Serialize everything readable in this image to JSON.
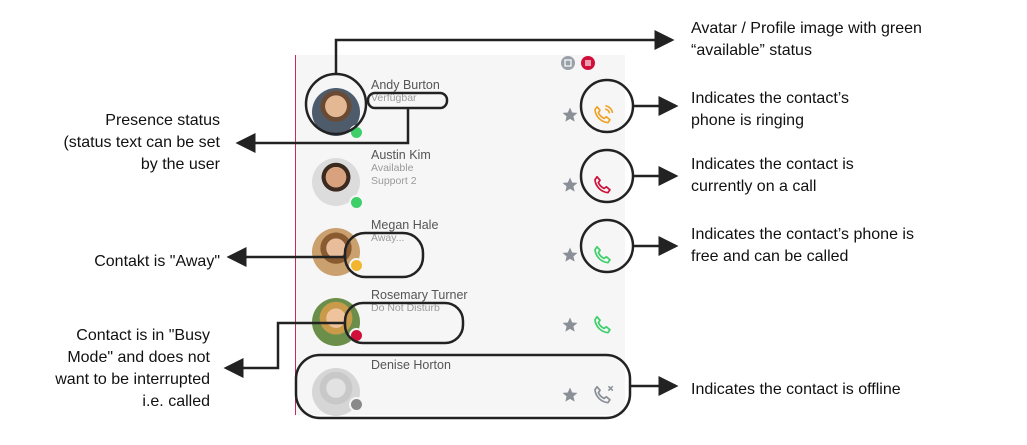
{
  "contacts": [
    {
      "name": "Andy Burton",
      "status": "Verfügbar",
      "extra": "",
      "presence": "available",
      "call_state": "ringing"
    },
    {
      "name": "Austin Kim",
      "status": "Available",
      "extra": "Support 2",
      "presence": "available",
      "call_state": "on-call"
    },
    {
      "name": "Megan Hale",
      "status": "Away...",
      "extra": "",
      "presence": "away",
      "call_state": "free"
    },
    {
      "name": "Rosemary Turner",
      "status": "Do Not Disturb",
      "extra": "",
      "presence": "busy",
      "call_state": "free"
    },
    {
      "name": "Denise Horton",
      "status": "",
      "extra": "",
      "presence": "offline",
      "call_state": "offline"
    }
  ],
  "annotations": {
    "avatar": [
      "Avatar / Profile image with green",
      "“available” status"
    ],
    "ringing": [
      "Indicates the contact’s",
      "phone is ringing"
    ],
    "on_call": [
      "Indicates the contact is",
      "currently on a call"
    ],
    "free": [
      "Indicates the contact’s phone is",
      "free and can be called"
    ],
    "offline": [
      "Indicates the contact is offline"
    ],
    "presence": [
      "Presence status",
      "(status text can be set",
      "by the user"
    ],
    "away": [
      "Contakt is \"Away\""
    ],
    "busy": [
      "Contact is in \"Busy",
      "Mode\" and does not",
      "want to be interrupted",
      "i.e. called"
    ]
  },
  "colors": {
    "available": "#3ecf6a",
    "away": "#f2b62e",
    "busy": "#d0103a",
    "offline": "#8a8a8a",
    "ringing": "#f0a020",
    "on_call": "#d0103a",
    "free": "#3ecf6a",
    "icon_gray": "#8a8f98"
  },
  "icons": [
    "list-icon",
    "menu-icon",
    "star-icon",
    "phone-icon",
    "phone-ringing-icon",
    "phone-offline-icon"
  ]
}
